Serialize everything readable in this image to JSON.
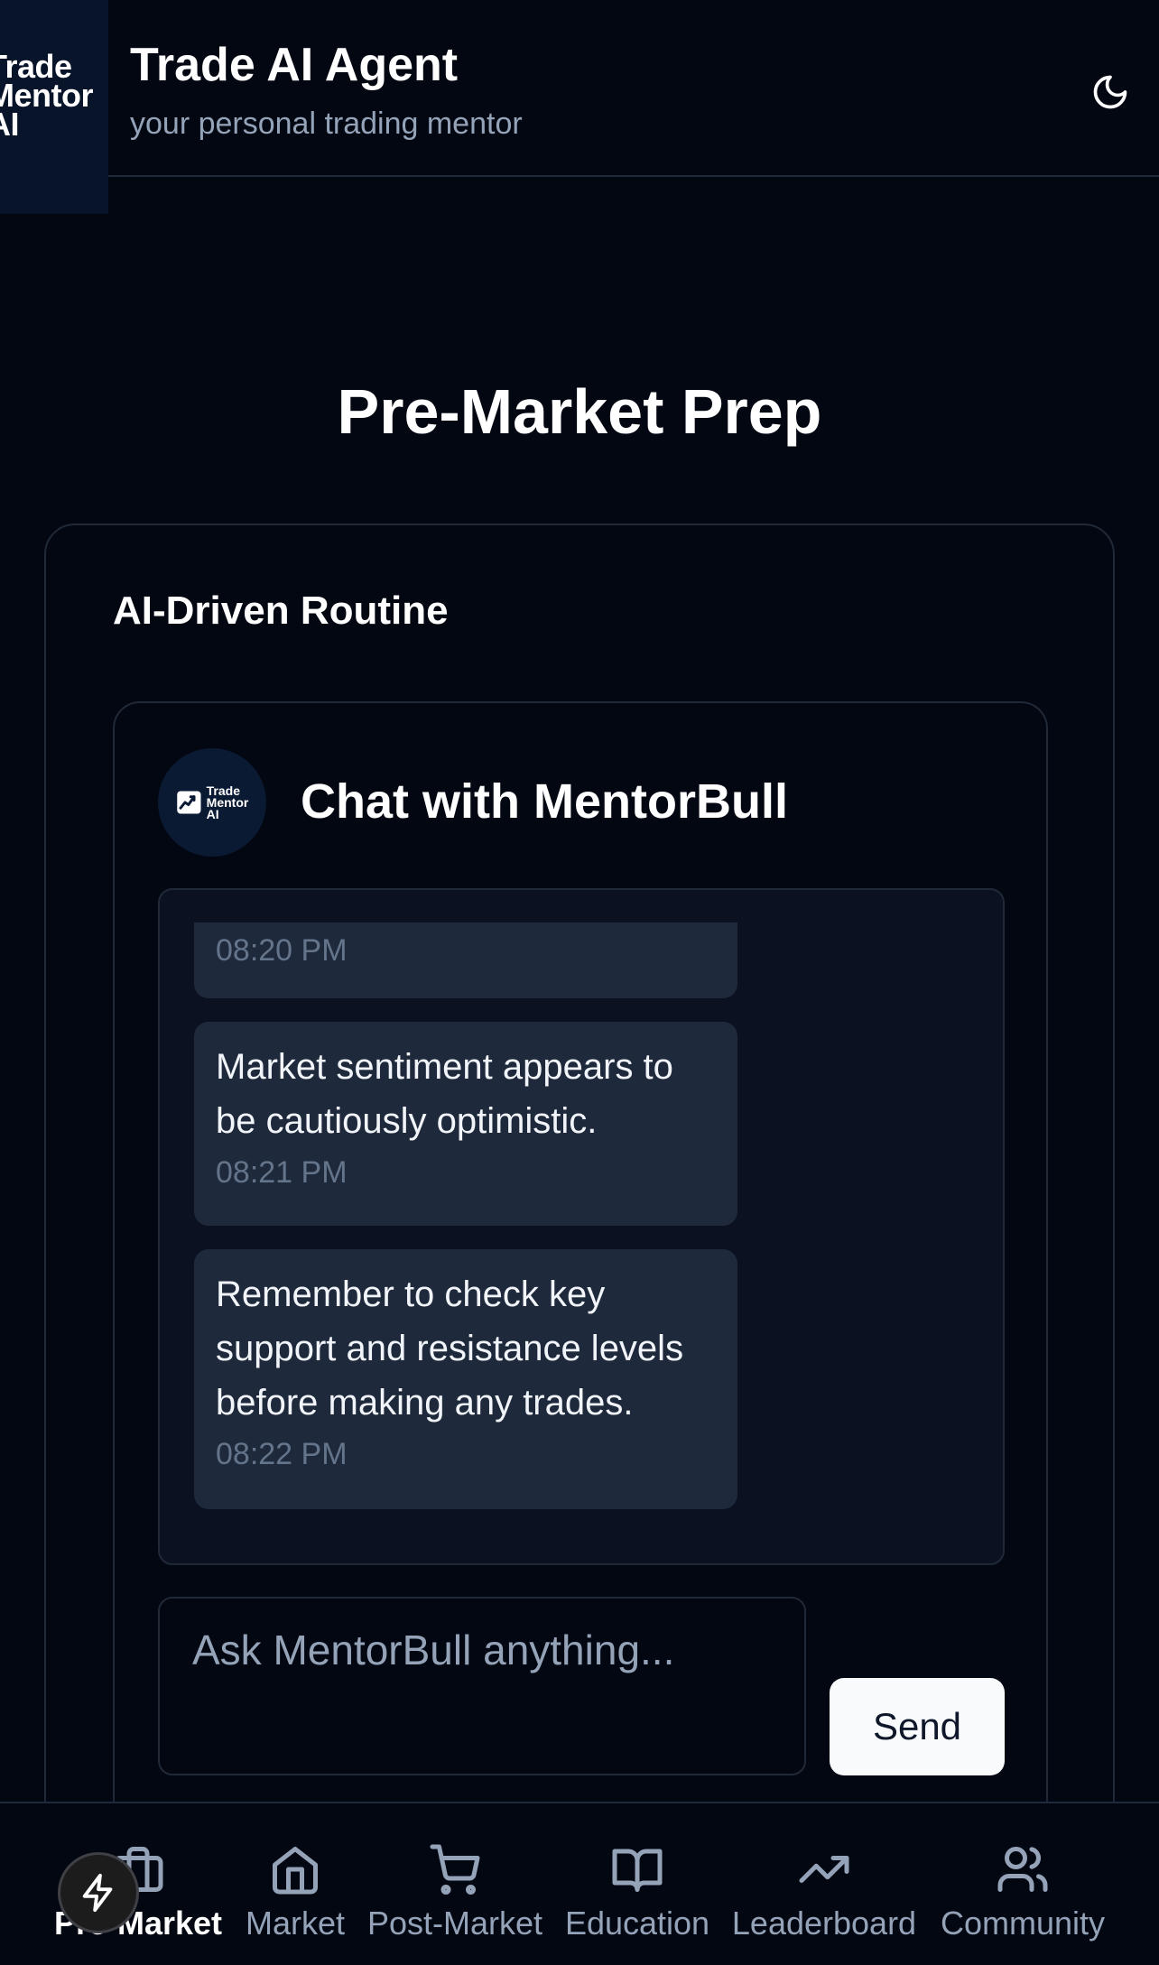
{
  "header": {
    "logo_text": "Trade\nMentor\nAI",
    "title": "Trade AI Agent",
    "subtitle": "your personal trading mentor",
    "theme_toggle_icon": "moon-icon"
  },
  "page": {
    "title": "Pre-Market Prep"
  },
  "routine": {
    "title": "AI-Driven Routine"
  },
  "chat": {
    "title": "Chat with MentorBull",
    "avatar_text": "Trade\nMentor\nAI",
    "messages": [
      {
        "text": "",
        "time": "08:20 PM"
      },
      {
        "text": "Market sentiment appears to be cautiously optimistic.",
        "time": "08:21 PM"
      },
      {
        "text": "Remember to check key support and resistance levels before making any trades.",
        "time": "08:22 PM"
      }
    ],
    "input_placeholder": "Ask MentorBull anything...",
    "send_label": "Send"
  },
  "nav": {
    "items": [
      {
        "label": "Pre-Market",
        "icon": "briefcase-icon",
        "active": true
      },
      {
        "label": "Market",
        "icon": "home-icon",
        "active": false
      },
      {
        "label": "Post-Market",
        "icon": "cart-icon",
        "active": false
      },
      {
        "label": "Education",
        "icon": "book-icon",
        "active": false
      },
      {
        "label": "Leaderboard",
        "icon": "trending-up-icon",
        "active": false
      },
      {
        "label": "Community",
        "icon": "users-icon",
        "active": false
      }
    ]
  },
  "fab": {
    "icon": "lightning-icon"
  },
  "colors": {
    "background": "#030712",
    "bubble": "#1e293b",
    "muted_text": "#94a3b8",
    "timestamp": "#64748b",
    "border": "#1f2937"
  }
}
